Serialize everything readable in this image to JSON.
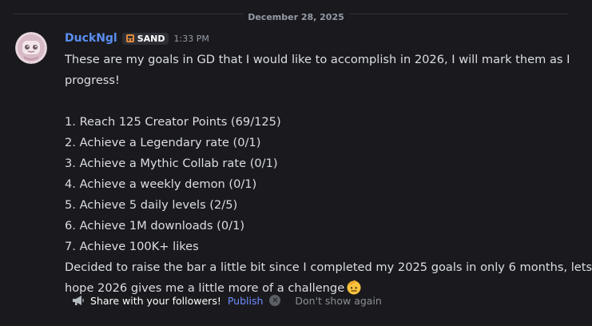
{
  "date_divider": "December 28, 2025",
  "message": {
    "author": "DuckNgl",
    "tag": "SAND",
    "timestamp": "1:33 PM",
    "intro_line1": "These are my goals in GD that I would like to accomplish in 2026, I will mark them as I",
    "intro_line2": "progress!",
    "goals": [
      "1. Reach 125 Creator Points (69/125)",
      "2. Achieve a Legendary rate (0/1)",
      "3. Achieve a Mythic Collab rate (0/1)",
      "4. Achieve a weekly demon (0/1)",
      "5. Achieve 5 daily levels (2/5)",
      "6. Achieve 1M downloads (0/1)",
      "7. Achieve 100K+ likes"
    ],
    "outro_line1": "Decided to raise the bar a little bit since I completed my 2025 goals in only 6 months, lets",
    "outro_line2": "hope 2026 gives me a little more of a challenge",
    "outro_emoji": "saluting-face-emoji"
  },
  "share_bar": {
    "text": "Share with your followers!",
    "publish": "Publish",
    "dont_show": "Don't show again",
    "icon": "megaphone-icon"
  },
  "colors": {
    "background": "#1a1a1e",
    "username": "#5a8ef2",
    "link": "#6f8bff",
    "text": "#dbdee1",
    "muted": "#949ba4"
  }
}
